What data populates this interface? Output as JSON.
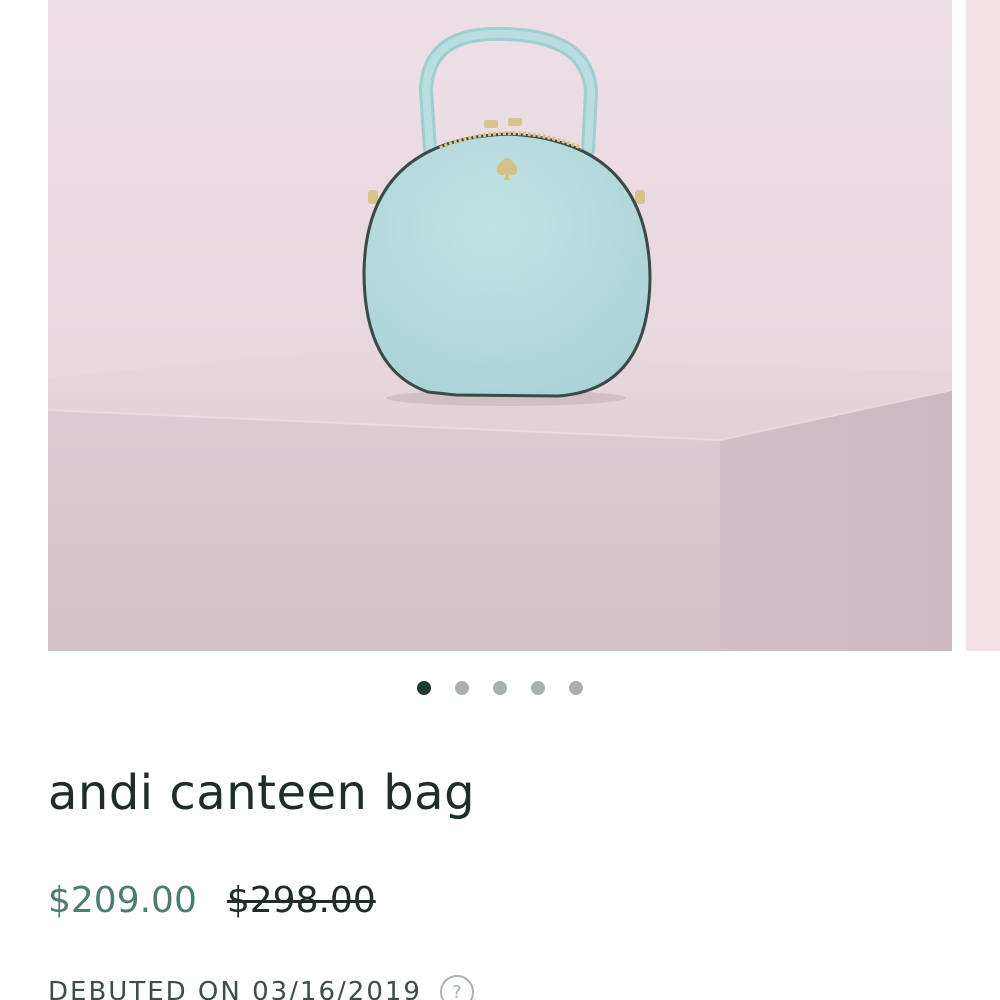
{
  "product": {
    "name": "andi canteen bag",
    "sale_price": "$209.00",
    "original_price": "$298.00",
    "debut_text": "DEBUTED ON 03/16/2019",
    "help_symbol": "?"
  },
  "carousel": {
    "slide_count": 5,
    "active_index": 0,
    "bag_color": "#b9dedf",
    "backdrop_color": "#ead9df"
  },
  "colors": {
    "title": "#1f2d27",
    "sale_price": "#4d7c72",
    "active_dot": "#203a2f",
    "inactive_dot": "#a6b1ad"
  }
}
